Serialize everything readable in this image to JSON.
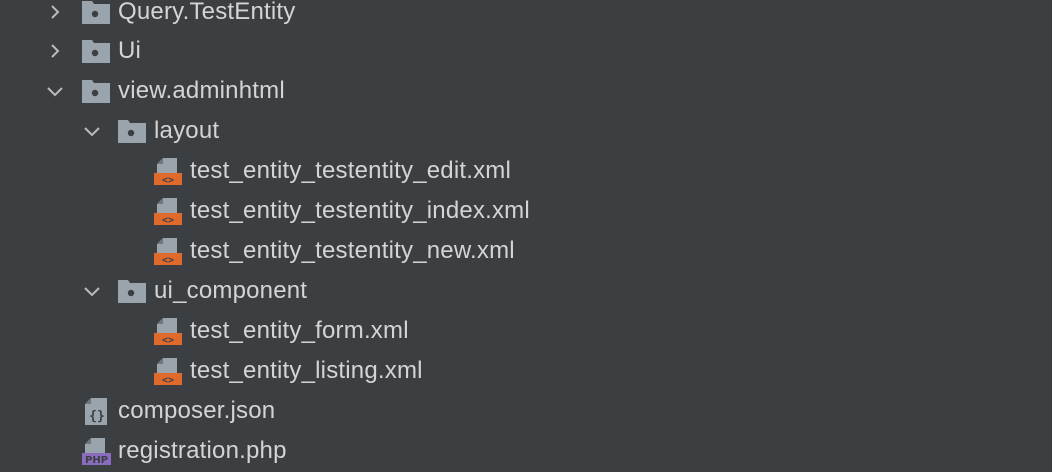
{
  "tree": {
    "items": [
      {
        "label": "Query.TestEntity",
        "type": "folder",
        "expanded": false,
        "depth": 0
      },
      {
        "label": "Ui",
        "type": "folder",
        "expanded": false,
        "depth": 0
      },
      {
        "label": "view.adminhtml",
        "type": "folder",
        "expanded": true,
        "depth": 0
      },
      {
        "label": "layout",
        "type": "folder",
        "expanded": true,
        "depth": 1
      },
      {
        "label": "test_entity_testentity_edit.xml",
        "type": "xml-file",
        "depth": 2
      },
      {
        "label": "test_entity_testentity_index.xml",
        "type": "xml-file",
        "depth": 2
      },
      {
        "label": "test_entity_testentity_new.xml",
        "type": "xml-file",
        "depth": 2
      },
      {
        "label": "ui_component",
        "type": "folder",
        "expanded": true,
        "depth": 1
      },
      {
        "label": "test_entity_form.xml",
        "type": "xml-file",
        "depth": 2
      },
      {
        "label": "test_entity_listing.xml",
        "type": "xml-file",
        "depth": 2
      },
      {
        "label": "composer.json",
        "type": "json-file",
        "depth": 0
      },
      {
        "label": "registration.php",
        "type": "php-file",
        "depth": 0
      }
    ]
  },
  "icons": {
    "php_badge": "PHP",
    "xml_badge": "<>",
    "json_badge": "{}"
  },
  "colors": {
    "background": "#3c3f41",
    "text": "#d4d4d4",
    "folder": "#9aa4ad",
    "xml": "#e06a2c",
    "php": "#8a6bbd"
  }
}
